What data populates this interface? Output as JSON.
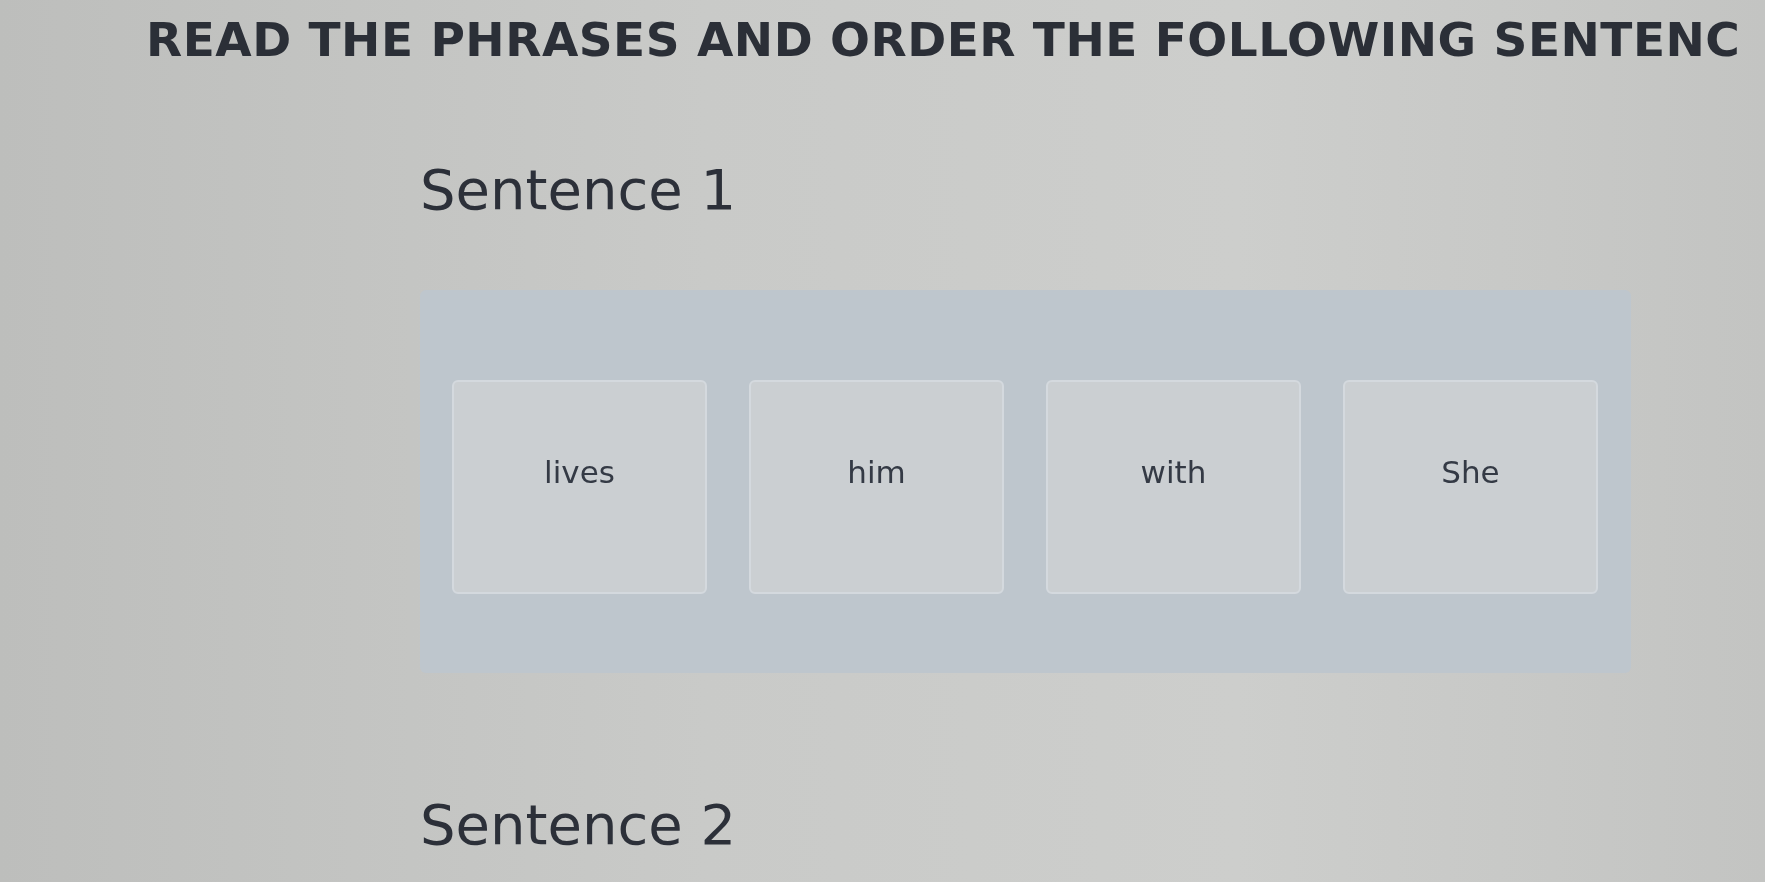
{
  "title": "READ THE PHRASES AND ORDER THE FOLLOWING SENTENC",
  "sentences": [
    {
      "heading": "Sentence 1",
      "phrases": [
        "lives",
        "him",
        "with",
        "She"
      ]
    },
    {
      "heading": "Sentence 2"
    }
  ]
}
